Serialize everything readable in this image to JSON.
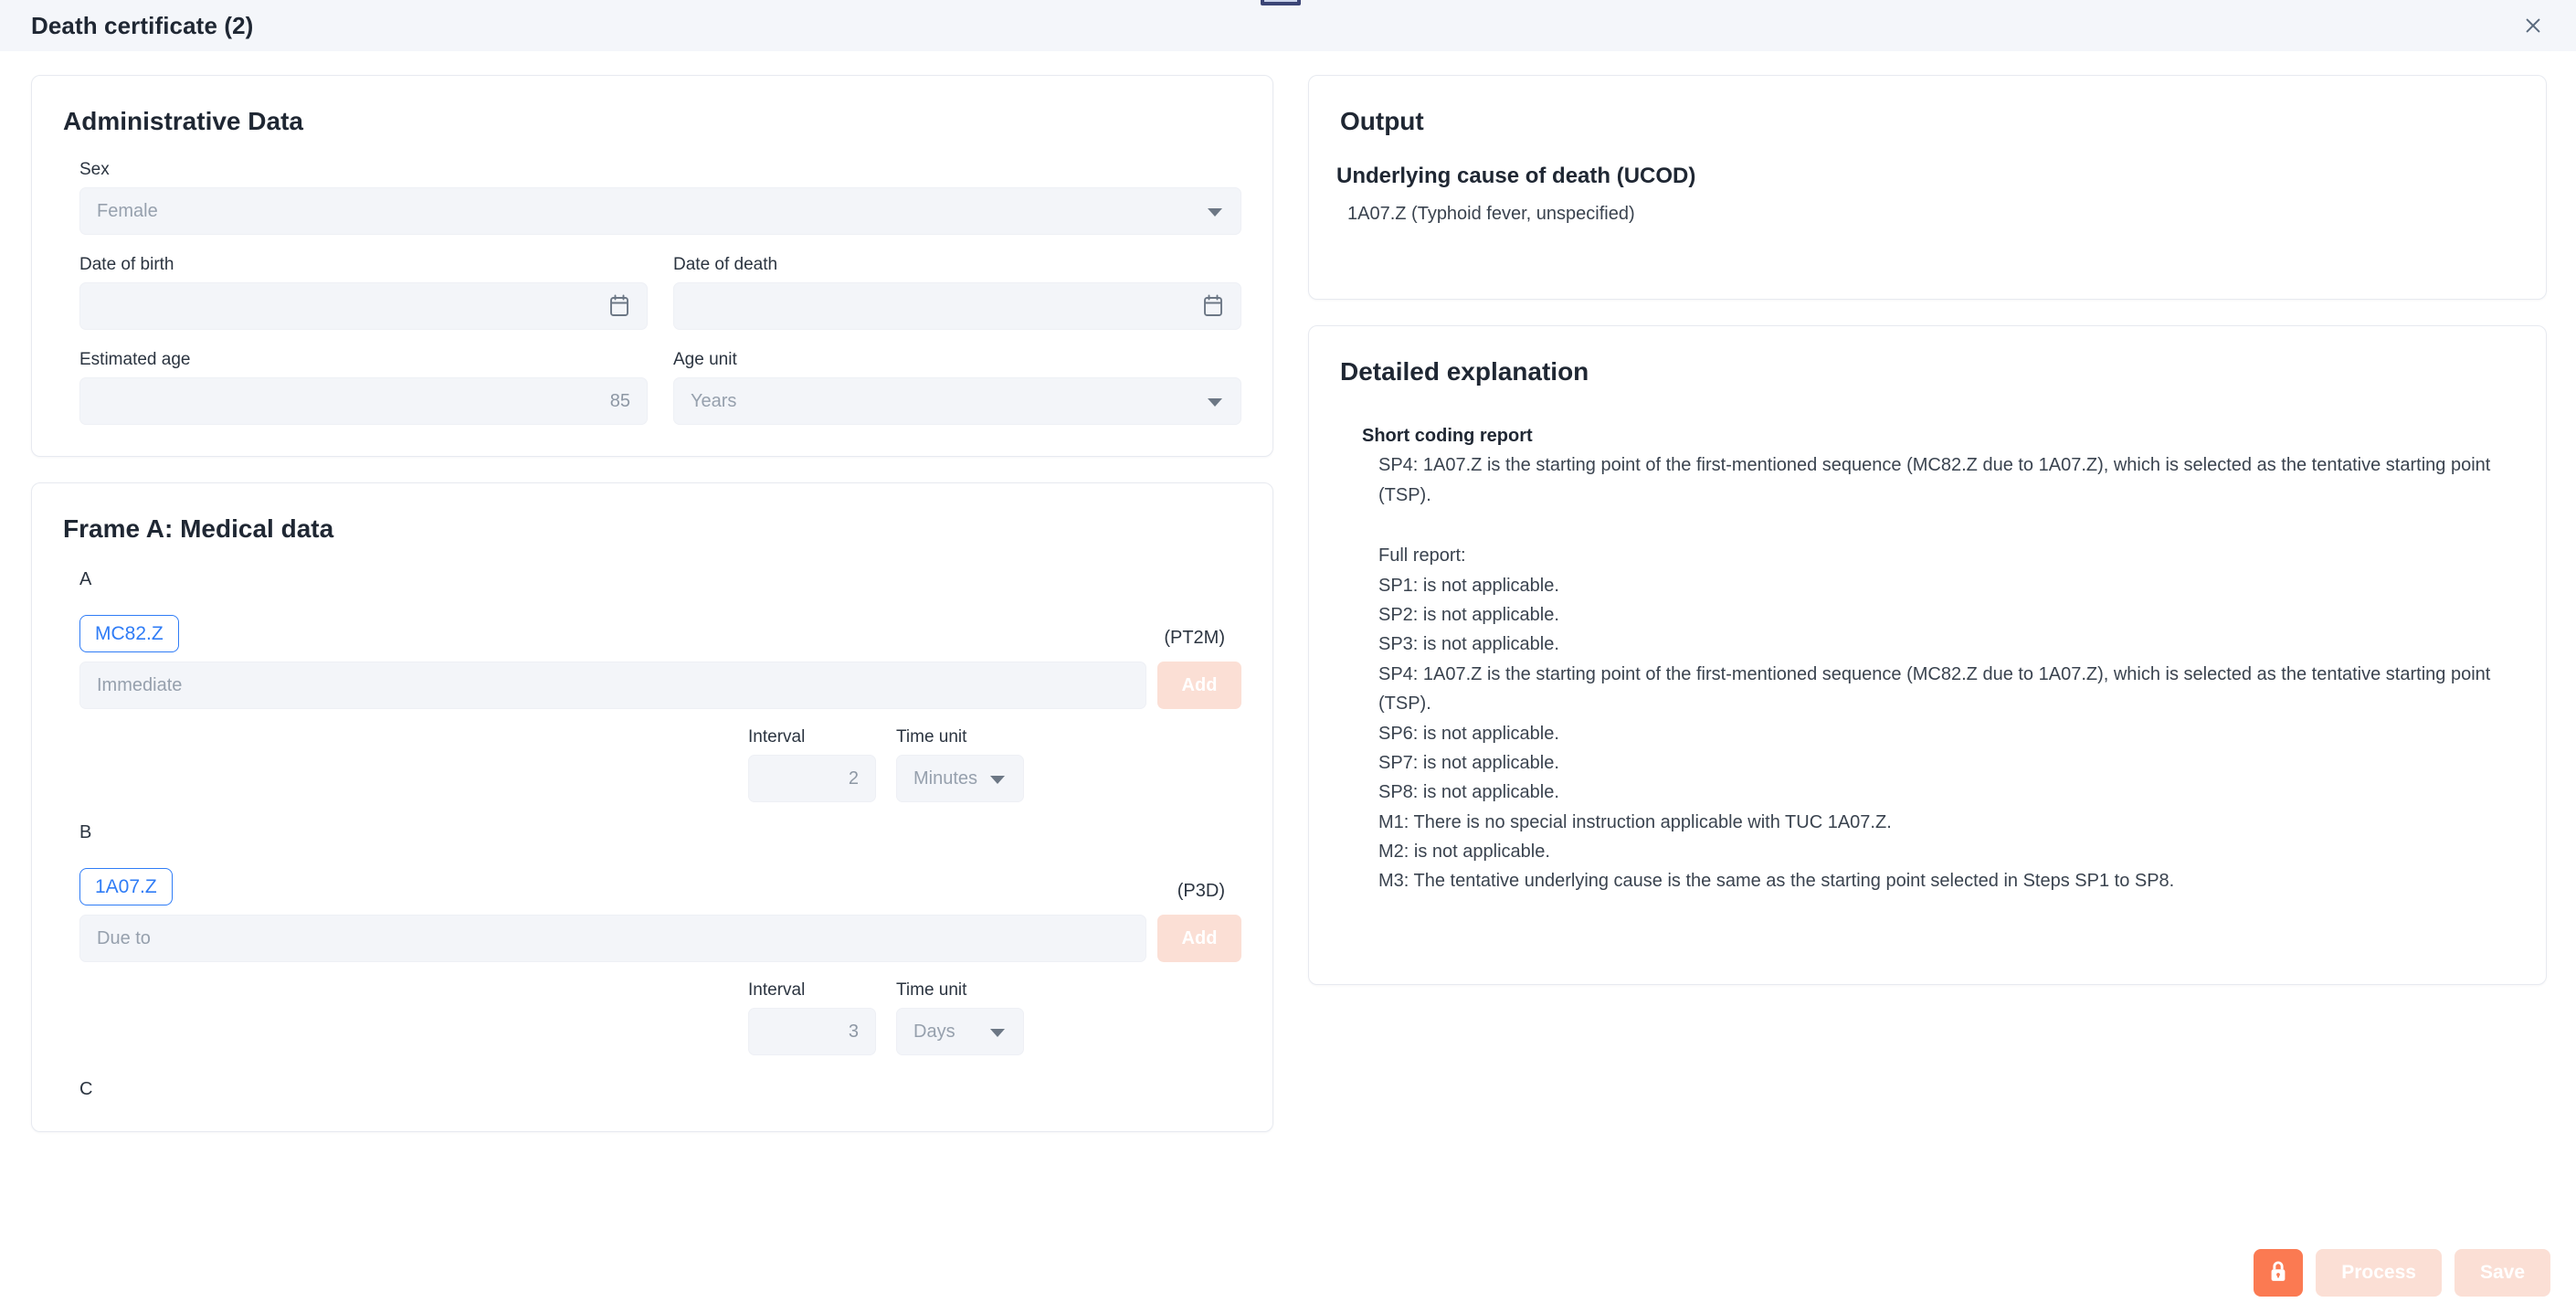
{
  "titlebar": {
    "title": "Death certificate (2)",
    "close_icon": "close-icon"
  },
  "administrative": {
    "card_title": "Administrative Data",
    "sex": {
      "label": "Sex",
      "value": "Female"
    },
    "date_of_birth": {
      "label": "Date of birth",
      "value": "",
      "icon": "calendar-icon"
    },
    "date_of_death": {
      "label": "Date of death",
      "value": "",
      "icon": "calendar-icon"
    },
    "estimated_age": {
      "label": "Estimated age",
      "value": "85"
    },
    "age_unit": {
      "label": "Age unit",
      "value": "Years"
    }
  },
  "frame_a": {
    "card_title": "Frame A: Medical data",
    "add_label": "Add",
    "interval_label": "Interval",
    "time_unit_label": "Time unit",
    "rows": [
      {
        "letter": "A",
        "code": "MC82.Z",
        "duration": "(PT2M)",
        "placeholder": "Immediate",
        "interval": "2",
        "time_unit": "Minutes"
      },
      {
        "letter": "B",
        "code": "1A07.Z",
        "duration": "(P3D)",
        "placeholder": "Due to",
        "interval": "3",
        "time_unit": "Days"
      }
    ],
    "next_letter": "C"
  },
  "output": {
    "card_title": "Output",
    "ucod_heading": "Underlying cause of death (UCOD)",
    "ucod_value": "1A07.Z (Typhoid fever, unspecified)"
  },
  "explanation": {
    "card_title": "Detailed explanation",
    "short_report_heading": "Short coding report",
    "short_report_line": "SP4: 1A07.Z is the starting point of the first-mentioned sequence (MC82.Z due to 1A07.Z), which is selected as the tentative starting point (TSP).",
    "full_report_heading": "Full report:",
    "full_report_lines": [
      "SP1: is not applicable.",
      "SP2: is not applicable.",
      "SP3: is not applicable.",
      "SP4: 1A07.Z is the starting point of the first-mentioned sequence (MC82.Z due to 1A07.Z), which is selected as the tentative starting point (TSP).",
      "SP6: is not applicable.",
      "SP7: is not applicable.",
      "SP8: is not applicable.",
      "M1: There is no special instruction applicable with TUC 1A07.Z.",
      "M2: is not applicable.",
      "M3: The tentative underlying cause is the same as the starting point selected in Steps SP1 to SP8."
    ]
  },
  "actions": {
    "lock_icon": "lock-icon",
    "process_label": "Process",
    "save_label": "Save"
  },
  "colors": {
    "accent_orange": "#fb7a52",
    "disabled_pink": "#fbdfd5",
    "chip_blue": "#2f7cf6",
    "titlebar_bg": "#f4f6fa"
  }
}
